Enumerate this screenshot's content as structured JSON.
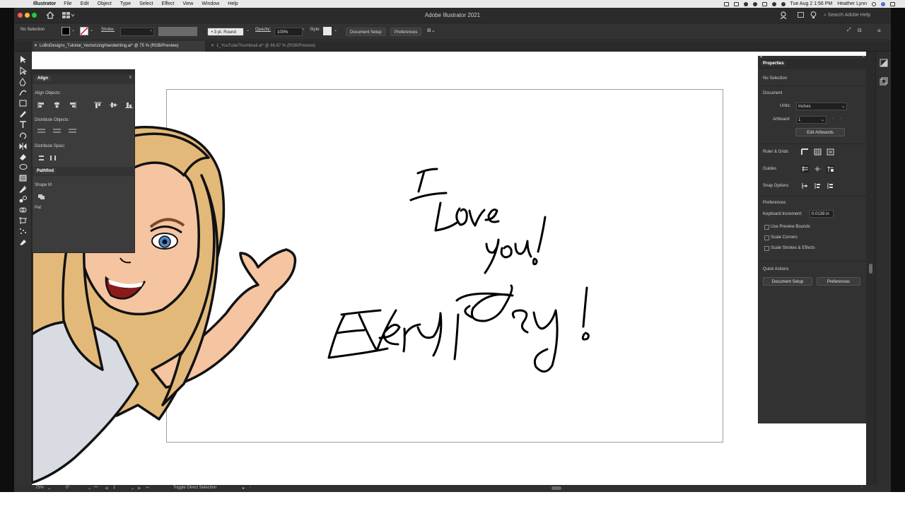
{
  "menubar": {
    "app_name": "Illustrator",
    "items": [
      "File",
      "Edit",
      "Object",
      "Type",
      "Select",
      "Effect",
      "View",
      "Window",
      "Help"
    ],
    "clock": "Tue Aug 2  1:56 PM",
    "user": "Heather Lynn"
  },
  "window": {
    "title": "Adobe Illustrator 2021",
    "search_placeholder": "Search Adobe Help"
  },
  "control_bar": {
    "selection": "No Selection",
    "stroke_label": "Stroke:",
    "brush": "3 pt. Round",
    "opacity_label": "Opacity:",
    "opacity_value": "100%",
    "style_label": "Style:",
    "document_setup": "Document Setup",
    "preferences": "Preferences"
  },
  "tabs": [
    {
      "label": "LoBoDesigns_Tutorial_VectorizingHandwriting.ai* @ 75 % (RGB/Preview)",
      "active": true
    },
    {
      "label": "1_YouTubeThumbnail.ai* @ 66.67 % (RGB/Preview)",
      "active": false
    }
  ],
  "align_panel": {
    "tab": "Align",
    "align_objects": "Align Objects:",
    "distribute_objects": "Distribute Objects:",
    "distribute_spacing": "Distribute Spaci",
    "pathfinder_tab": "Pathfind",
    "shape_modes": "Shape M",
    "pathfinders": "Pat"
  },
  "properties": {
    "title": "Properties",
    "selection": "No Selection",
    "document": "Document",
    "units_label": "Units:",
    "units_value": "Inches",
    "artboard_label": "Artboard:",
    "artboard_value": "1",
    "edit_artboards": "Edit Artboards",
    "ruler_grids": "Ruler & Grids",
    "guides": "Guides",
    "snap_options": "Snap Options",
    "preferences": "Preferences",
    "keyboard_increment_label": "Keyboard Increment:",
    "keyboard_increment_value": "0.0139 in",
    "checkboxes": [
      "Use Preview Bounds",
      "Scale Corners",
      "Scale Strokes & Effects"
    ],
    "quick_actions": "Quick Actions",
    "document_setup_btn": "Document Setup",
    "preferences_btn": "Preferences"
  },
  "statusbar": {
    "zoom": "75%",
    "rotation": "0°",
    "artboard": "1",
    "tool_hint": "Toggle Direct Selection"
  },
  "colors": {
    "panel": "#323232",
    "canvas": "#ffffff",
    "accent": "#2680eb"
  }
}
